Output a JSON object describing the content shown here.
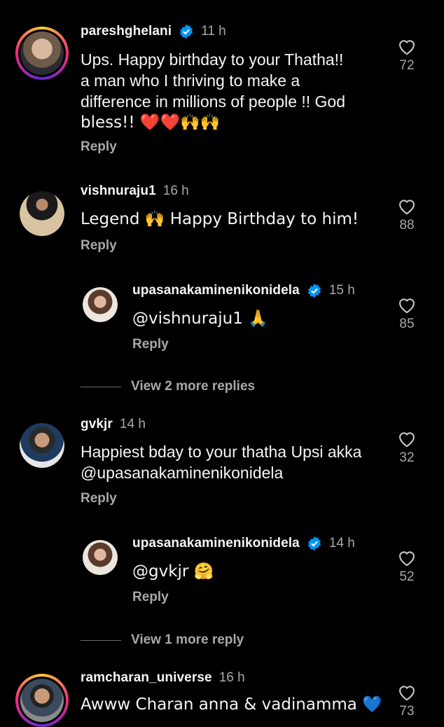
{
  "comments": [
    {
      "username": "pareshghelani",
      "time": "11 h",
      "text_lines": [
        "Ups. Happy birthday to your Thatha!!",
        "a man who I thriving to make a",
        "difference in millions of people !! God",
        "bless!! ❤️❤️🙌🙌"
      ],
      "reply": "Reply",
      "likes": "72"
    },
    {
      "username": "vishnuraju1",
      "time": "16 h",
      "text_lines": [
        "Legend 🙌 Happy Birthday to him!"
      ],
      "reply": "Reply",
      "likes": "88"
    },
    {
      "username": "upasanakaminenikonidela",
      "time": "15 h",
      "text_lines": [
        "@vishnuraju1 🙏"
      ],
      "reply": "Reply",
      "likes": "85"
    },
    {
      "username": "gvkjr",
      "time": "14 h",
      "text_lines": [
        "Happiest bday to your thatha Upsi akka",
        "@upasanakaminenikonidela"
      ],
      "reply": "Reply",
      "likes": "32"
    },
    {
      "username": "upasanakaminenikonidela",
      "time": "14 h",
      "text_lines": [
        "@gvkjr 🤗"
      ],
      "reply": "Reply",
      "likes": "52"
    },
    {
      "username": "ramcharan_universe",
      "time": "16 h",
      "text_lines": [
        "Awww Charan anna & vadinamma 💙"
      ],
      "likes": "73"
    }
  ],
  "view_more": [
    "View 2 more replies",
    "View 1 more reply"
  ],
  "icons": {
    "like": "heart-outline-icon",
    "verified": "verified-badge-icon"
  },
  "colors": {
    "background": "#000000",
    "primary_text": "#f5f5f5",
    "secondary_text": "#a8a8a8",
    "verified": "#0095f6"
  }
}
